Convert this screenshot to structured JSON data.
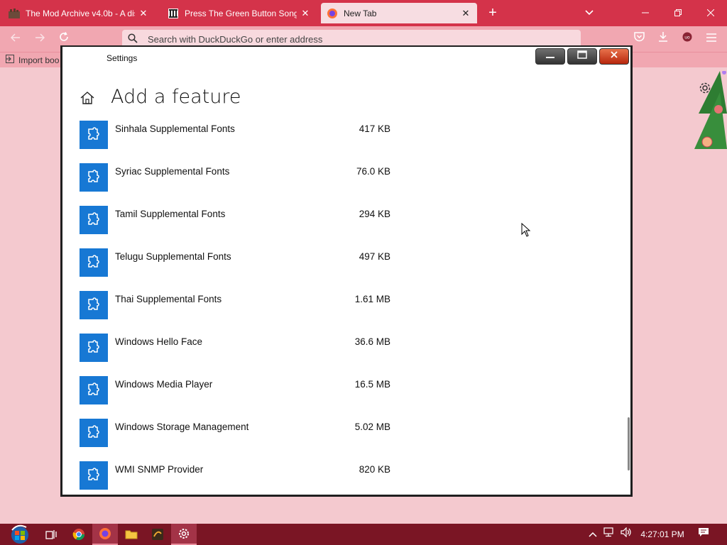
{
  "browser": {
    "tabs": [
      {
        "title": "The Mod Archive v4.0b - A dist",
        "close": "✕"
      },
      {
        "title": "Press The Green Button Songs C",
        "close": "✕"
      },
      {
        "title": "New Tab",
        "close": "✕"
      }
    ],
    "new_tab_symbol": "+",
    "address_placeholder": "Search with DuckDuckGo or enter address",
    "bookmark_label": "Import boo"
  },
  "settings": {
    "window_title": "Settings",
    "page_title": "Add a feature",
    "features": [
      {
        "name": "Sinhala Supplemental Fonts",
        "size": "417 KB"
      },
      {
        "name": "Syriac Supplemental Fonts",
        "size": "76.0 KB"
      },
      {
        "name": "Tamil Supplemental Fonts",
        "size": "294 KB"
      },
      {
        "name": "Telugu Supplemental Fonts",
        "size": "497 KB"
      },
      {
        "name": "Thai Supplemental Fonts",
        "size": "1.61 MB"
      },
      {
        "name": "Windows Hello Face",
        "size": "36.6 MB"
      },
      {
        "name": "Windows Media Player",
        "size": "16.5 MB"
      },
      {
        "name": "Windows Storage Management",
        "size": "5.02 MB"
      },
      {
        "name": "WMI SNMP Provider",
        "size": "820 KB"
      }
    ]
  },
  "taskbar": {
    "clock": "4:27:01 PM"
  },
  "colors": {
    "browser_accent": "#d4334a",
    "feature_icon_bg": "#1778d4",
    "taskbar_bg": "#7a1524"
  }
}
